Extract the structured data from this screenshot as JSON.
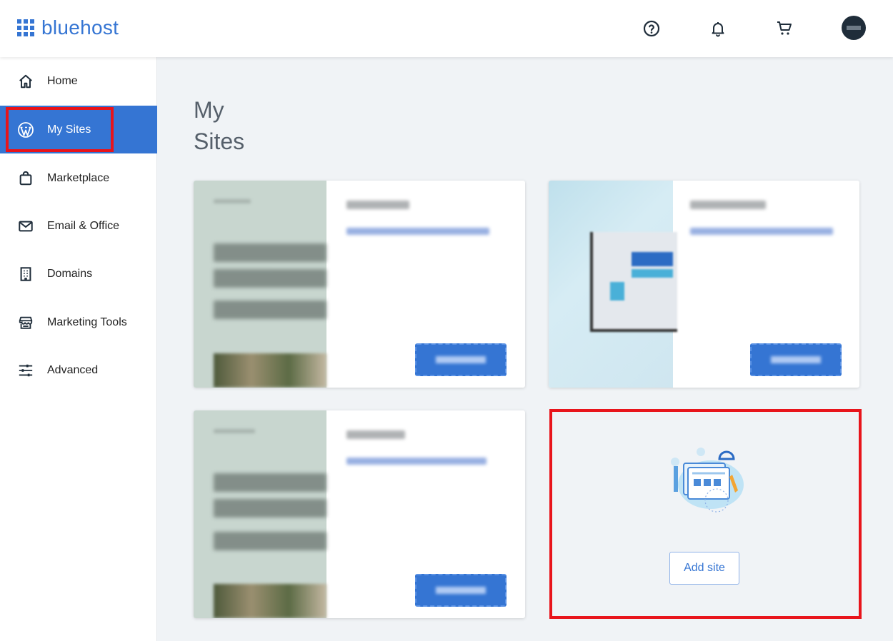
{
  "header": {
    "brand": "bluehost",
    "icons": [
      "help-icon",
      "bell-icon",
      "cart-icon",
      "avatar"
    ]
  },
  "sidebar": {
    "items": [
      {
        "label": "Home",
        "icon": "home-icon"
      },
      {
        "label": "My Sites",
        "icon": "wordpress-icon",
        "active": true
      },
      {
        "label": "Marketplace",
        "icon": "shopping-bag-icon"
      },
      {
        "label": "Email & Office",
        "icon": "envelope-icon"
      },
      {
        "label": "Domains",
        "icon": "building-icon"
      },
      {
        "label": "Marketing Tools",
        "icon": "storefront-icon"
      },
      {
        "label": "Advanced",
        "icon": "sliders-icon"
      }
    ]
  },
  "main": {
    "title_line1": "My",
    "title_line2": "Sites",
    "add_site_label": "Add site"
  },
  "colors": {
    "brand_blue": "#3575d3",
    "highlight_red": "#e8141b",
    "page_bg": "#f0f3f6"
  }
}
